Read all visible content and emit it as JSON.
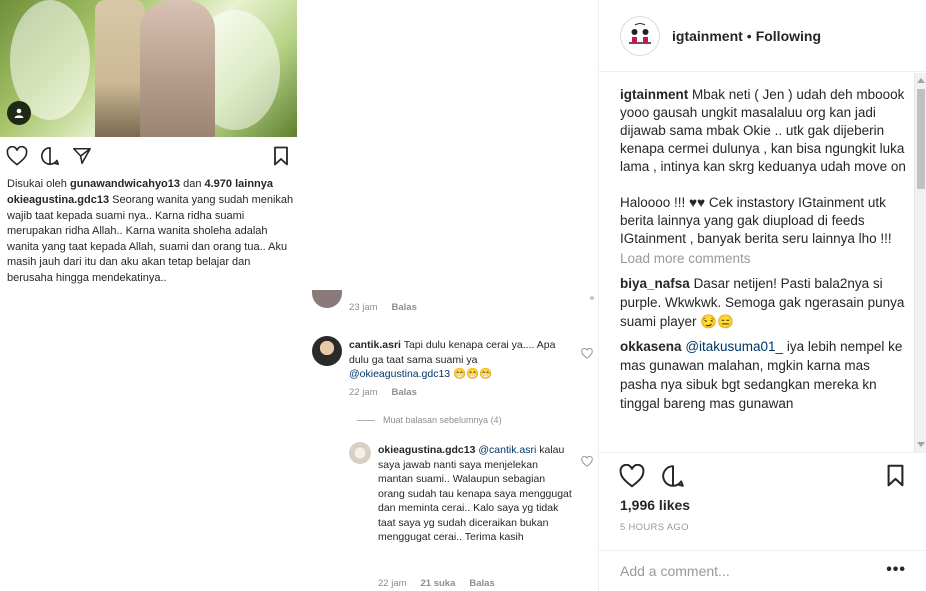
{
  "embedded_post": {
    "liked_by_prefix": "Disukai oleh",
    "liked_by_user": "gunawandwicahyo13",
    "liked_by_and": "dan",
    "liked_by_count": "4.970 lainnya",
    "caption_user": "okieagustina.gdc13",
    "caption_text": "Seorang wanita yang sudah menikah wajib taat kepada suami nya.. Karna ridha suami merupakan ridha Allah.. Karna wanita sholeha adalah wanita yang taat kepada Allah, suami dan orang tua.. Aku masih jauh dari itu dan aku akan tetap belajar dan berusaha hingga mendekatinya.."
  },
  "embedded_thread": {
    "prev_meta": {
      "time": "23 jam",
      "reply": "Balas"
    },
    "comment1": {
      "user": "cantik.asri",
      "text": "Tapi dulu kenapa cerai ya.... Apa dulu ga taat sama suami ya",
      "mention": "@okieagustina.gdc13",
      "emoji": "😁😁😁",
      "time": "22 jam",
      "reply": "Balas"
    },
    "view_replies": "Muat balasan sebelumnya (4)",
    "reply1": {
      "user": "okieagustina.gdc13",
      "mention": "@cantik.asri",
      "text": "kalau saya jawab nanti saya menjelekan mantan suami.. Walaupun sebagian orang sudah tau kenapa saya menggugat dan meminta cerai.. Kalo saya yg tidak taat saya yg sudah diceraikan bukan menggugat cerai.. Terima kasih",
      "time": "22 jam",
      "likes": "21 suka",
      "reply": "Balas"
    }
  },
  "header": {
    "username": "igtainment",
    "separator": "•",
    "follow_status": "Following"
  },
  "caption": {
    "user": "igtainment",
    "text": "Mbak neti ( Jen ) udah deh mboook yooo gausah ungkit masalaluu org kan jadi dijawab sama mbak Okie .. utk gak dijeberin kenapa cermei dulunya , kan bisa ngungkit luka lama , intinya kan skrg keduanya udah move on\n\nHaloooo !!! ♥♥ Cek instastory IGtainment utk berita lainnya yang gak diupload di feeds IGtainment , banyak berita seru lainnya lho !!!"
  },
  "load_more": "Load more comments",
  "comments": [
    {
      "user": "biya_nafsa",
      "text": "Dasar netijen! Pasti bala2nya si purple. Wkwkwk. Semoga gak ngerasain punya suami player 😏😑",
      "mention": ""
    },
    {
      "user": "okkasena",
      "mention": "@itakusuma01_",
      "text": "iya lebih nempel ke mas gunawan malahan, mgkin karna mas pasha nya sibuk bgt sedangkan mereka kn tinggal bareng mas gunawan"
    }
  ],
  "likes": "1,996 likes",
  "timestamp": "5 HOURS AGO",
  "add_comment_placeholder": "Add a comment...",
  "more_label": "•••",
  "icons": {
    "heart": "heart-icon",
    "comment": "comment-icon",
    "share": "share-icon",
    "bookmark": "bookmark-icon",
    "user_tag": "user-tag-icon"
  }
}
